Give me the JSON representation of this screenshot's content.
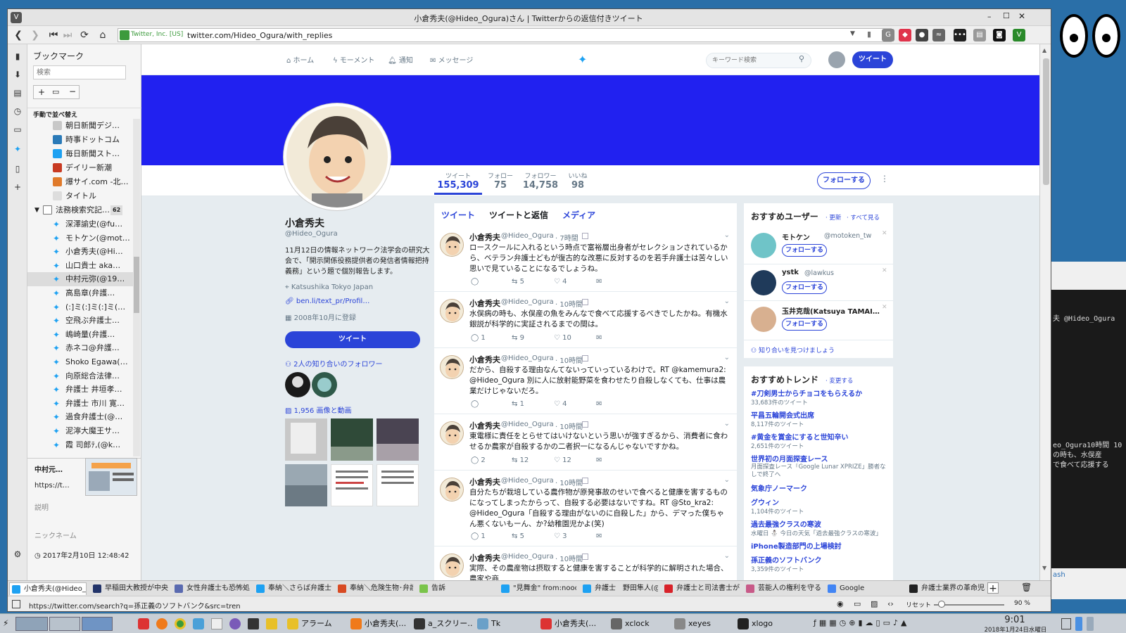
{
  "window": {
    "title": "小倉秀夫(@Hideo_Ogura)さん | Twitterからの返信付きツイート",
    "url": "twitter.com/Hideo_Ogura/with_replies",
    "security_label": "Twitter, Inc. [US]"
  },
  "bookmarks": {
    "header": "ブックマーク",
    "search_placeholder": "検索",
    "sort_label": "手動で並べ替え",
    "items": [
      "朝日新聞デジ…",
      "時事ドットコム",
      "毎日新聞スト…",
      "デイリー新潮",
      "爆サイ.com -北…",
      "タイトル"
    ],
    "folder": {
      "label": "法務検索究記…",
      "count": "62"
    },
    "folder_items": [
      "深澤諭史(@fu…",
      "モトケン(@mot…",
      "小倉秀夫(@Hi…",
      "山口貴士 aka…",
      "中村元弥(@19…",
      "高島章(弁護…",
      "(:]ミ(:]ミ(:]ミ(…",
      "空飛ぶ弁護士…",
      "嶋崎量(弁護…",
      "赤ネコ@弁護…",
      "Shoko Egawa(…",
      "向原総合法律…",
      "弁護士 井垣孝…",
      "弁護士 市川 寛…",
      "過食弁護士(@…",
      "泥濘大魔王サ…",
      "霞 司郎ﾃ,(@k…"
    ],
    "preview": {
      "title": "中村元…",
      "url": "https://t…",
      "desc_label": "説明",
      "nick_label": "ニックネーム",
      "date": "2017年2月10日 12:48:42"
    }
  },
  "twitter": {
    "nav": {
      "home": "ホーム",
      "moments": "モーメント",
      "notifications": "通知",
      "messages": "メッセージ",
      "search_placeholder": "キーワード検索",
      "tweet_btn": "ツイート"
    },
    "stats": [
      {
        "label": "ツイート",
        "value": "155,309"
      },
      {
        "label": "フォロー",
        "value": "75"
      },
      {
        "label": "フォロワー",
        "value": "14,758"
      },
      {
        "label": "いいね",
        "value": "98"
      }
    ],
    "follow_btn": "フォローする",
    "profile": {
      "name": "小倉秀夫",
      "handle": "@Hideo_Ogura",
      "bio": "11月12日の情報ネットワーク法学会の研究大会で、「開示関係役務提供者の発信者情報把持義務」という題で個別報告します。",
      "location": "Katsushika Tokyo Japan",
      "link": "ben.li/text_pr/Profil…",
      "joined": "2008年10月に登録",
      "tweet_btn": "ツイート",
      "followers_known": "2人の知り合いのフォロワー",
      "media": "1,956 画像と動画"
    },
    "tabs": [
      "ツイート",
      "ツイートと返信",
      "メディア"
    ],
    "tweets": [
      {
        "name": "小倉秀夫",
        "handle": "@Hideo_Ogura",
        "time": "· 7時間",
        "text": "ロースクールに入れるという時点で富裕層出身者がセレクションされているから、ベテラン弁護士どもが復古的な改悪に反対するのを若手弁護士は苦々しい思いで見ていることになるでしょうね。",
        "replies": "",
        "retweets": "5",
        "likes": "4"
      },
      {
        "name": "小倉秀夫",
        "handle": "@Hideo_Ogura",
        "time": "· 10時間",
        "text": "水俣病の時も、水俣産の魚をみんなで食べて応援するべきでしたかね。有機水銀説が科学的に実証されるまでの間は。",
        "replies": "1",
        "retweets": "9",
        "likes": "10"
      },
      {
        "name": "小倉秀夫",
        "handle": "@Hideo_Ogura",
        "time": "· 10時間",
        "text": "だから、自殺する理由なんてないっていっているわけで。RT @kamemura2: @Hideo_Ogura 別に人に放射能野菜を食わせたり自殺しなくても、仕事は農業だけじゃないだろ。",
        "replies": "",
        "retweets": "1",
        "likes": "4"
      },
      {
        "name": "小倉秀夫",
        "handle": "@Hideo_Ogura",
        "time": "· 10時間",
        "text": "東電様に責任をとらせてはいけないという思いが強すぎるから、消費者に食わせるか農家が自殺するかの二者択一になるんじゃないですかね。",
        "replies": "2",
        "retweets": "12",
        "likes": "12"
      },
      {
        "name": "小倉秀夫",
        "handle": "@Hideo_Ogura",
        "time": "· 10時間",
        "text": "自分たちが栽培している農作物が原発事故のせいで食べると健康を害するものになってしまったからって、自殺する必要はないですね。RT @Sto_kra2: @Hideo_Ogura「自殺する理由がないのに自殺した」から、デマった僕ちゃん悪くないもーん、か?幼稚園児かよ(笑)",
        "replies": "1",
        "retweets": "5",
        "likes": "3"
      },
      {
        "name": "小倉秀夫",
        "handle": "@Hideo_Ogura",
        "time": "· 10時間",
        "text": "実際、その農産物は摂取すると健康を害することが科学的に解明された場合、農家や商",
        "replies": "",
        "retweets": "",
        "likes": ""
      }
    ],
    "suggestions": {
      "title": "おすすめユーザー",
      "refresh": "· 更新",
      "view_all": "· すべて見る",
      "users": [
        {
          "name": "モトケン",
          "handle": "@motoken_tw"
        },
        {
          "name": "ystk",
          "handle": "@lawkus"
        },
        {
          "name": "玉井克哉(Katsuya TAMAI…",
          "handle": ""
        }
      ],
      "find_friends": "知り合いを見つけましょう"
    },
    "trends": {
      "title": "おすすめトレンド",
      "change": "· 変更する",
      "items": [
        {
          "name": "#刀剣男士からチョコをもらえるか",
          "meta": "33,683件のツイート"
        },
        {
          "name": "平昌五輪開会式出席",
          "meta": "8,117件のツイート"
        },
        {
          "name": "#黄金を賞金にすると世知辛い",
          "meta": "2,651件のツイート"
        },
        {
          "name": "世界初の月面探査レース",
          "meta": "月面探査レース「Google Lunar XPRIZE」勝者なしで終了へ"
        },
        {
          "name": "気象庁ノーマーク",
          "meta": ""
        },
        {
          "name": "グウィン",
          "meta": "1,104件のツイート"
        },
        {
          "name": "過去最強クラスの寒波",
          "meta": "水曜日 ⛄ 今日の天気「過去最強クラスの寒波」"
        },
        {
          "name": "iPhone製造部門の上場検討",
          "meta": ""
        },
        {
          "name": "孫正義のソフトバンク",
          "meta": "3,359件のツイート"
        }
      ]
    }
  },
  "tabs": [
    "小倉秀夫(@Hideo_O",
    "早稲田大教授が中央",
    "女性弁護士も恐怖処",
    "奉納＼さらば弁護士",
    "奉納＼危険生物･弁護",
    "告訴",
    "\"見舞金\" from:nooo",
    "弁護士　野田隼人(@",
    "弁護士と司法書士が",
    "芸能人の権利を守る",
    "Google",
    "弁護士業界の革命児"
  ],
  "status": {
    "url": "https://twitter.com/search?q=孫正義のソフトバンク&src=tren",
    "reset": "リセット",
    "zoom": "90 %"
  },
  "taskbar": {
    "apps": [
      "アラーム",
      "小倉秀夫(…",
      "a_スクリー…",
      "Tk",
      "小倉秀夫(…",
      "xclock",
      "xeyes",
      "xlogo"
    ],
    "time": "9:01",
    "date": "2018年1月24日水曜日"
  },
  "terminal": {
    "lines": [
      "夫 @Hideo_Ogura",
      "eo_Ogura10時間 10",
      "の時も、水俣産",
      "で食べて応援する"
    ],
    "footer": "ash"
  }
}
